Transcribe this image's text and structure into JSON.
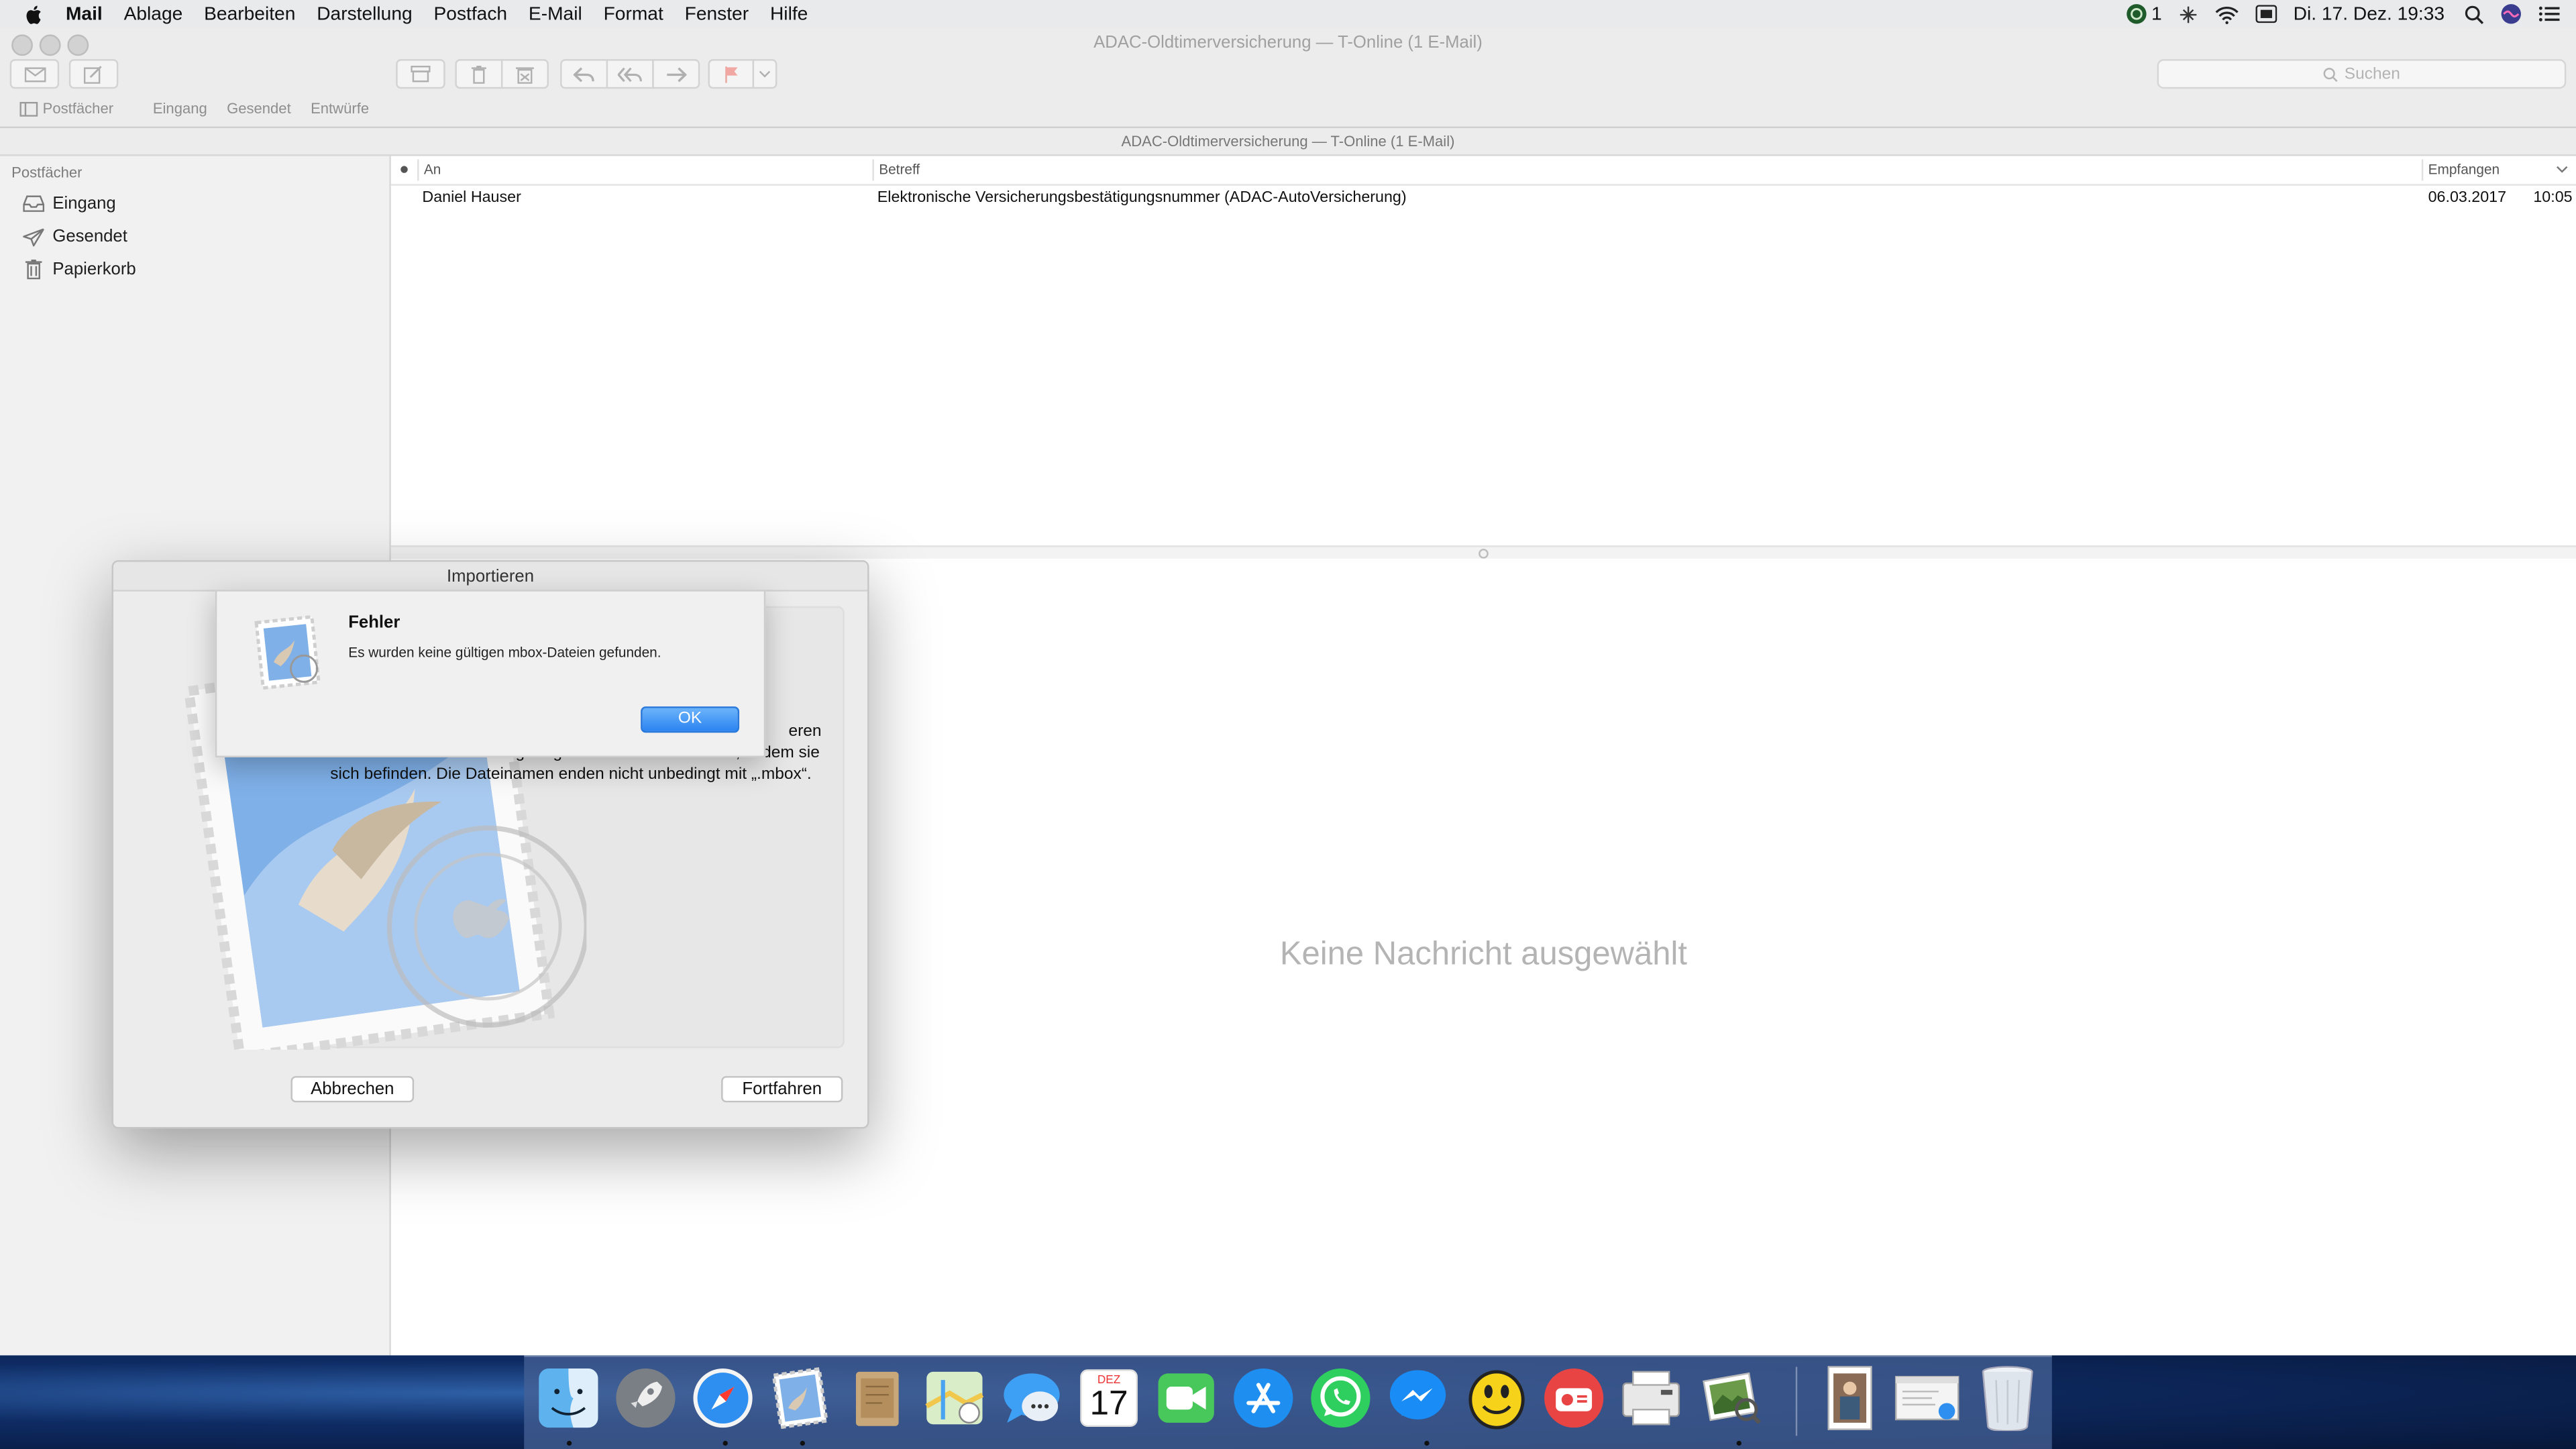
{
  "menubar": {
    "app": "Mail",
    "items": [
      "Ablage",
      "Bearbeiten",
      "Darstellung",
      "Postfach",
      "E-Mail",
      "Format",
      "Fenster",
      "Hilfe"
    ],
    "status_badge": "1",
    "datetime": "Di. 17. Dez.  19:33"
  },
  "window": {
    "title": "ADAC-Oldtimerversicherung — T-Online (1 E-Mail)",
    "subtitle": "ADAC-Oldtimerversicherung — T-Online (1 E-Mail)",
    "search_placeholder": "Suchen",
    "favorites": [
      "Postfächer",
      "Eingang",
      "Gesendet",
      "Entwürfe"
    ]
  },
  "sidebar": {
    "heading": "Postfächer",
    "items": [
      {
        "label": "Eingang",
        "icon": "inbox-icon"
      },
      {
        "label": "Gesendet",
        "icon": "sent-icon"
      },
      {
        "label": "Papierkorb",
        "icon": "trash-icon"
      }
    ]
  },
  "message_list": {
    "columns": {
      "to": "An",
      "subject": "Betreff",
      "received": "Empfangen"
    },
    "rows": [
      {
        "to": "Daniel Hauser",
        "subject": "Elektronische Versicherungsbestätigungsnummer (ADAC-AutoVersicherung)",
        "date": "06.03.2017",
        "time": "10:05"
      }
    ]
  },
  "viewer": {
    "empty_text": "Keine Nachricht ausgewählt"
  },
  "import_dialog": {
    "title": "Importieren",
    "text_fragment": "eren",
    "text": "Dateien im mbox-Format gefragt oder nach dem Ordner, in dem sie sich befinden. Die Dateinamen enden nicht unbedingt mit „.mbox“.",
    "cancel": "Abbrechen",
    "continue": "Fortfahren"
  },
  "error_sheet": {
    "title": "Fehler",
    "message": "Es wurden keine gültigen mbox-Dateien gefunden.",
    "ok": "OK"
  },
  "dock": {
    "calendar_month": "DEZ",
    "calendar_day": "17",
    "apps": [
      "Finder",
      "Launchpad",
      "Safari",
      "Mail",
      "Notes",
      "Maps",
      "Messages",
      "Calendar",
      "FaceTime",
      "App Store",
      "WhatsApp",
      "Messenger",
      "Emoji",
      "Radio",
      "Printer",
      "Preview"
    ]
  },
  "colors": {
    "accent": "#2b84f1",
    "menubar": "#e9eaec",
    "sidebar": "#f1f1f1"
  }
}
